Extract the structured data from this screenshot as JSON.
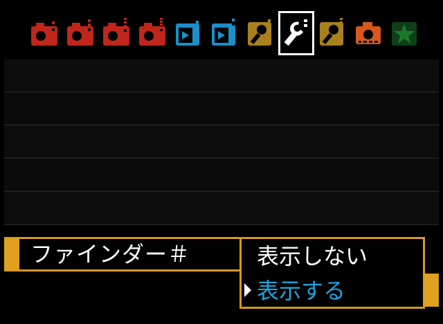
{
  "colors": {
    "red": "#c0261c",
    "blue": "#1a8fc8",
    "yellow": "#a8801c",
    "orange": "#d8581c",
    "green": "#1a7a2a",
    "accent": "#d89a1c",
    "selected_option": "#1aa6e0"
  },
  "tabs": [
    {
      "icon": "shooting-icon",
      "color": "red",
      "dots": 1,
      "active": false
    },
    {
      "icon": "shooting-icon",
      "color": "red",
      "dots": 2,
      "active": false
    },
    {
      "icon": "shooting-icon",
      "color": "red",
      "dots": 3,
      "active": false
    },
    {
      "icon": "shooting-icon",
      "color": "red",
      "dots": 4,
      "active": false
    },
    {
      "icon": "playback-icon",
      "color": "blue",
      "dots": 1,
      "active": false
    },
    {
      "icon": "playback-icon",
      "color": "blue",
      "dots": 2,
      "active": false
    },
    {
      "icon": "wrench-icon",
      "color": "yellow",
      "dots": 1,
      "active": false
    },
    {
      "icon": "wrench-icon",
      "color": "yellow",
      "dots": 2,
      "active": true
    },
    {
      "icon": "wrench-icon",
      "color": "yellow",
      "dots": 3,
      "active": false
    },
    {
      "icon": "custom-camera-icon",
      "color": "orange",
      "dots": 0,
      "active": false
    },
    {
      "icon": "star-icon",
      "color": "green",
      "dots": 0,
      "active": false
    }
  ],
  "menu": {
    "selected_item_label": "ファインダー＃",
    "options": [
      "表示しない",
      "表示する"
    ],
    "selected_option_index": 1
  }
}
